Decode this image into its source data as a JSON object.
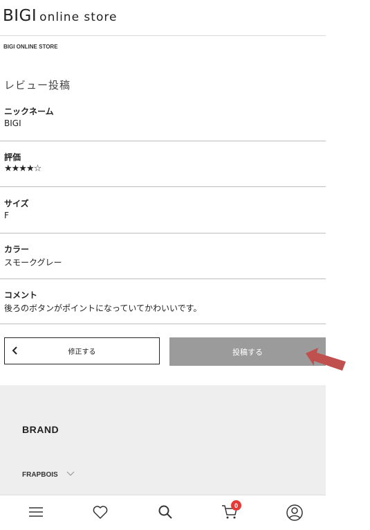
{
  "header": {
    "logo_main": "BIGI",
    "logo_sub": "online store"
  },
  "breadcrumb": "BIGI ONLINE STORE",
  "page_title": "レビュー投稿",
  "fields": [
    {
      "label": "ニックネーム",
      "value": "BIGI"
    },
    {
      "label": "評価",
      "value": "★★★★☆"
    },
    {
      "label": "サイズ",
      "value": "F"
    },
    {
      "label": "カラー",
      "value": "スモークグレー"
    },
    {
      "label": "コメント",
      "value": "後ろのボタンがポイントになっていてかわいいです。"
    }
  ],
  "rating": {
    "value": 4,
    "max": 5
  },
  "actions": {
    "edit_label": "修正する",
    "submit_label": "投稿する"
  },
  "footer": {
    "heading": "BRAND",
    "brand_item": "FRAPBOIS"
  },
  "bottom_nav": {
    "items": [
      "menu-icon",
      "heart-icon",
      "search-icon",
      "cart-icon",
      "account-icon"
    ],
    "cart_count": "0"
  },
  "colors": {
    "submit_bg": "#9b9b9b",
    "arrow": "#c0504d",
    "badge": "#e53935",
    "footer_bg": "#eeeeee"
  }
}
